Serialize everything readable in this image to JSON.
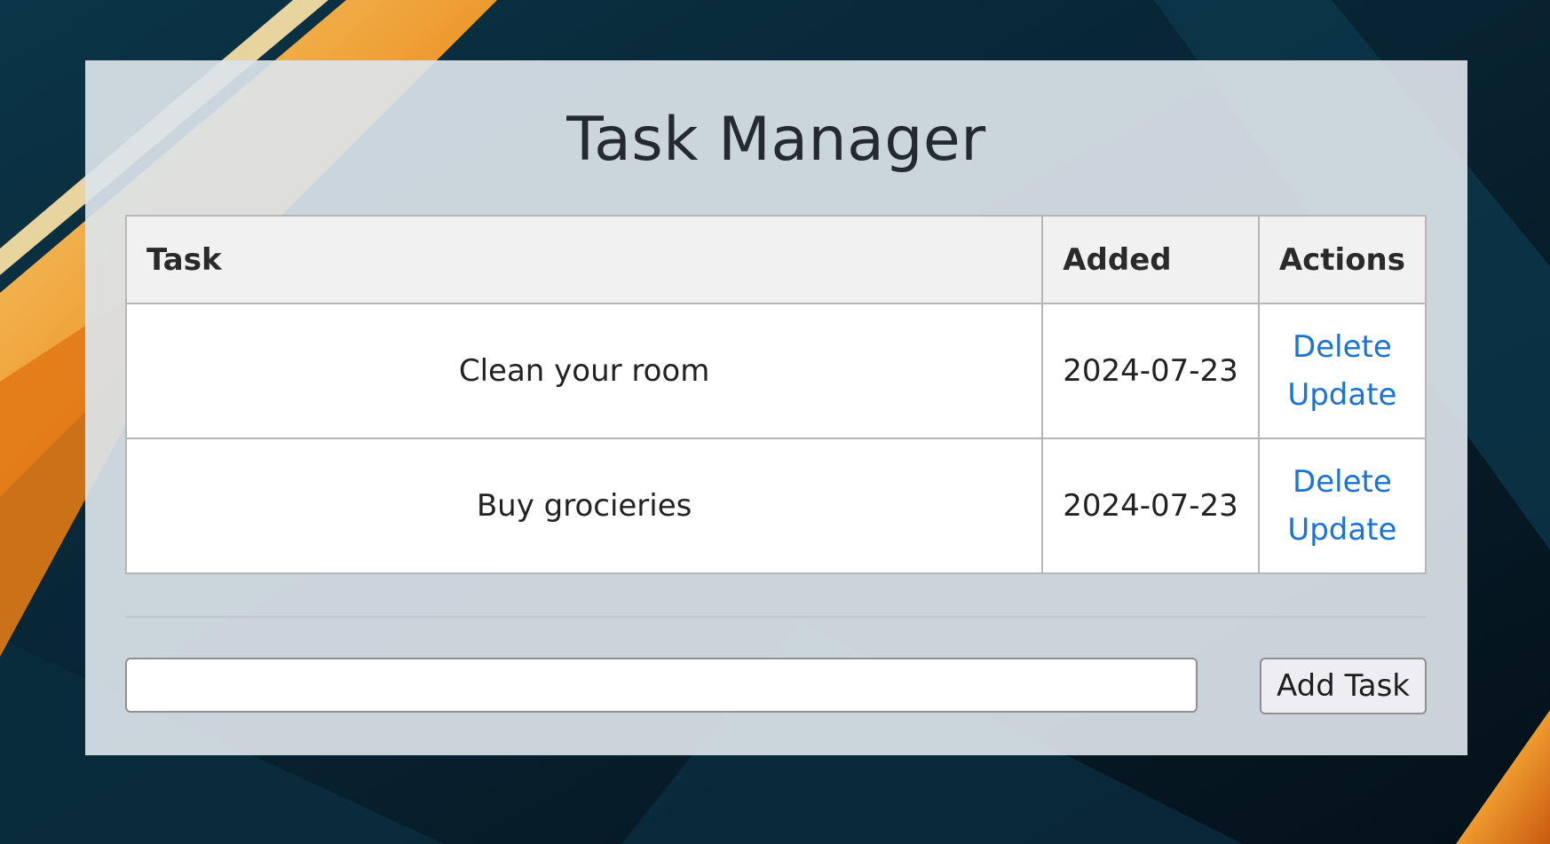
{
  "page": {
    "title": "Task Manager"
  },
  "table": {
    "headers": {
      "task": "Task",
      "added": "Added",
      "actions": "Actions"
    },
    "rows": [
      {
        "task": "Clean your room",
        "added": "2024-07-23",
        "delete_label": "Delete",
        "update_label": "Update"
      },
      {
        "task": "Buy grocieries",
        "added": "2024-07-23",
        "delete_label": "Delete",
        "update_label": "Update"
      }
    ]
  },
  "form": {
    "input_value": "",
    "input_placeholder": "",
    "add_button_label": "Add Task"
  },
  "colors": {
    "link": "#1a74d2",
    "card_background": "#dce4ea",
    "header_background": "#f1f1f1",
    "page_background": "#04131c",
    "accent_orange": "#e8891f"
  }
}
